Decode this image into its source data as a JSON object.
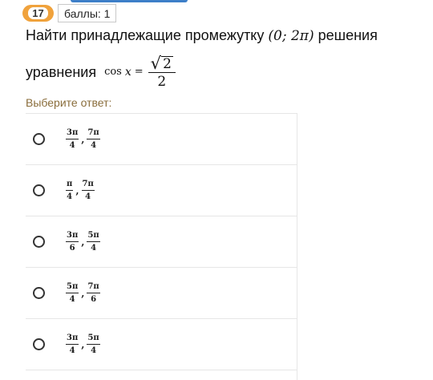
{
  "header": {
    "question_number": "17",
    "score_label": "баллы: 1"
  },
  "question": {
    "line1_text": "Найти принадлежащие промежутку",
    "interval": "(0; 2π)",
    "line1_tail": "решения",
    "line2_text": "уравнения",
    "eq_fn": "cos",
    "eq_var": "x",
    "eq_sign": "=",
    "rad_value": "2",
    "den_value": "2"
  },
  "prompt": "Выберите ответ:",
  "options": [
    {
      "a_num": "3π",
      "a_den": "4",
      "b_num": "7π",
      "b_den": "4"
    },
    {
      "a_num": "π",
      "a_den": "4",
      "b_num": "7π",
      "b_den": "4"
    },
    {
      "a_num": "3π",
      "a_den": "6",
      "b_num": "5π",
      "b_den": "4"
    },
    {
      "a_num": "5π",
      "a_den": "4",
      "b_num": "7π",
      "b_den": "6"
    },
    {
      "a_num": "3π",
      "a_den": "4",
      "b_num": "5π",
      "b_den": "4"
    }
  ],
  "colors": {
    "badge": "#f0a23c",
    "prompt": "#8a6d3b",
    "top_strip": "#3d7fc8"
  }
}
